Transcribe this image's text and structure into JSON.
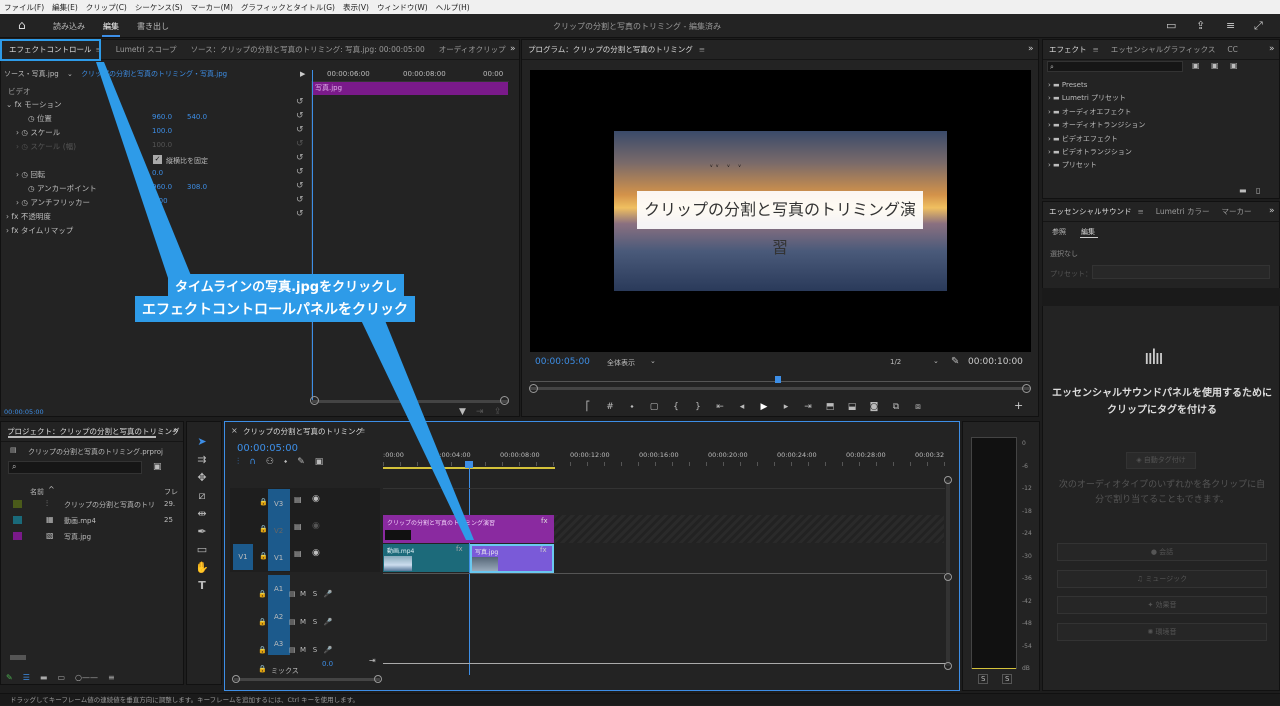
{
  "menu": [
    "ファイル(F)",
    "編集(E)",
    "クリップ(C)",
    "シーケンス(S)",
    "マーカー(M)",
    "グラフィックとタイトル(G)",
    "表示(V)",
    "ウィンドウ(W)",
    "ヘルプ(H)"
  ],
  "workspace": {
    "tabs": [
      "読み込み",
      "編集",
      "書き出し"
    ],
    "title": "クリップの分割と写真のトリミング - 編集済み"
  },
  "effect_controls": {
    "tabs": [
      "エフェクトコントロール",
      "Lumetri スコープ",
      "ソース：クリップの分割と写真のトリミング: 写真.jpg: 00:00:05:00",
      "オーディオクリップ"
    ],
    "source_label": "ソース・写真.jpg",
    "clip_path": "クリップの分割と写真のトリミング・写真.jpg",
    "time_marks": [
      "00:00:06:00",
      "00:00:08:00",
      "00:00"
    ],
    "clip_bar": "写真.jpg",
    "video_header": "ビデオ",
    "motion": "モーション",
    "props": [
      {
        "name": "位置",
        "v1": "960.0",
        "v2": "540.0"
      },
      {
        "name": "スケール",
        "v1": "100.0",
        "v2": ""
      },
      {
        "name": "スケール (幅)",
        "v1": "100.0",
        "v2": ""
      },
      {
        "name": "縦横比を固定",
        "v1": "",
        "v2": ""
      },
      {
        "name": "回転",
        "v1": "0.0",
        "v2": ""
      },
      {
        "name": "アンカーポイント",
        "v1": "960.0",
        "v2": "308.0"
      },
      {
        "name": "アンチフリッカー",
        "v1": "0.00",
        "v2": ""
      }
    ],
    "opacity": "不透明度",
    "timeremap": "タイムリマップ",
    "time": "00:00:05:00"
  },
  "program": {
    "tab": "プログラム：クリップの分割と写真のトリミング",
    "title_overlay": "クリップの分割と写真のトリミング演習",
    "timecode": "00:00:05:00",
    "fit": "全体表示",
    "resolution": "1/2",
    "duration": "00:00:10:00"
  },
  "callout": {
    "line1": "タイムラインの写真.jpgをクリックし",
    "line2": "エフェクトコントロールパネルをクリック"
  },
  "project": {
    "tab": "プロジェクト：クリップの分割と写真のトリミング",
    "file": "クリップの分割と写真のトリミング.prproj",
    "col_name": "名前",
    "col_fps": "フレ",
    "items": [
      {
        "name": "クリップの分割と写真のトリ",
        "fps": "29.",
        "color": "#4a5a1a"
      },
      {
        "name": "動画.mp4",
        "fps": "25",
        "color": "#1a6a7a"
      },
      {
        "name": "写真.jpg",
        "fps": "",
        "color": "#7a1a8a"
      }
    ]
  },
  "timeline": {
    "tab": "クリップの分割と写真のトリミング",
    "timecode": "00:00:05:00",
    "ruler": [
      ":00:00",
      "00:00:04:00",
      "00:00:08:00",
      "00:00:12:00",
      "00:00:16:00",
      "00:00:20:00",
      "00:00:24:00",
      "00:00:28:00",
      "00:00:32"
    ],
    "tracks_v": [
      "V3",
      "V2",
      "V1"
    ],
    "tracks_a": [
      "A1",
      "A2",
      "A3"
    ],
    "mix": "ミックス",
    "mix_val": "0.0",
    "clip_title": "クリップの分割と写真のトリミング演習",
    "clip_video": "動画.mp4",
    "clip_photo": "写真.jpg",
    "v1_src": "V1"
  },
  "meter": {
    "labels": [
      "0",
      "-6",
      "-12",
      "-18",
      "-24",
      "-30",
      "-36",
      "-42",
      "-48",
      "-54",
      "dB"
    ],
    "s": "S"
  },
  "effects": {
    "tabs": [
      "エフェクト",
      "エッセンシャルグラフィックス",
      "CC"
    ],
    "items": [
      "Presets",
      "Lumetri プリセット",
      "オーディオエフェクト",
      "オーディオトランジション",
      "ビデオエフェクト",
      "ビデオトランジション",
      "プリセット"
    ]
  },
  "essential_sound": {
    "tabs": [
      "エッセンシャルサウンド",
      "Lumetri カラー",
      "マーカー"
    ],
    "subtabs": [
      "参照",
      "編集"
    ],
    "none": "選択なし",
    "preset": "プリセット：",
    "msg": "エッセンシャルサウンドパネルを使用するためにクリップにタグを付ける",
    "auto": "自動タグ付け",
    "desc": "次のオーディオタイプのいずれかを各クリップに自分で割り当てることもできます。",
    "types": [
      "会話",
      "ミュージック",
      "効果音",
      "環境音"
    ]
  },
  "status": "ドラッグしてキーフレーム値の連続値を垂直方向に調整します。キーフレームを追加するには、Ctrl キーを使用します。"
}
